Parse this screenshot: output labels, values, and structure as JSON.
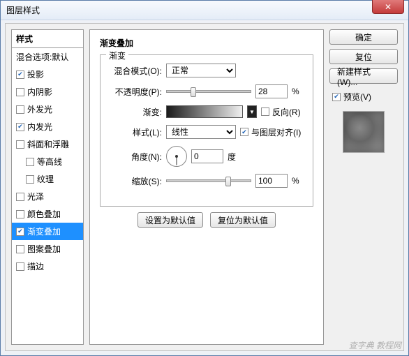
{
  "window": {
    "title": "图层样式",
    "close": "✕"
  },
  "left": {
    "header": "样式",
    "blend_options": "混合选项:默认",
    "items": [
      {
        "label": "投影",
        "checked": true
      },
      {
        "label": "内阴影",
        "checked": false
      },
      {
        "label": "外发光",
        "checked": false
      },
      {
        "label": "内发光",
        "checked": true
      },
      {
        "label": "斜面和浮雕",
        "checked": false
      },
      {
        "label": "等高线",
        "checked": false,
        "indent": true
      },
      {
        "label": "纹理",
        "checked": false,
        "indent": true
      },
      {
        "label": "光泽",
        "checked": false
      },
      {
        "label": "颜色叠加",
        "checked": false
      },
      {
        "label": "渐变叠加",
        "checked": true,
        "selected": true
      },
      {
        "label": "图案叠加",
        "checked": false
      },
      {
        "label": "描边",
        "checked": false
      }
    ]
  },
  "center": {
    "title": "渐变叠加",
    "group": "渐变",
    "blend_mode_label": "混合模式(O):",
    "blend_mode_value": "正常",
    "opacity_label": "不透明度(P):",
    "opacity_value": "28",
    "opacity_unit": "%",
    "opacity_thumb_pct": 28,
    "gradient_label": "渐变:",
    "reverse_label": "反向(R)",
    "reverse_checked": false,
    "style_label": "样式(L):",
    "style_value": "线性",
    "align_label": "与图层对齐(I)",
    "align_checked": true,
    "angle_label": "角度(N):",
    "angle_value": "0",
    "angle_unit": "度",
    "scale_label": "缩放(S):",
    "scale_value": "100",
    "scale_unit": "%",
    "scale_thumb_pct": 70,
    "reset_default": "设置为默认值",
    "restore_default": "复位为默认值"
  },
  "right": {
    "ok": "确定",
    "cancel": "复位",
    "new_style": "新建样式(W)...",
    "preview_label": "预览(V)",
    "preview_checked": true
  },
  "watermark": "查字典 教程网"
}
